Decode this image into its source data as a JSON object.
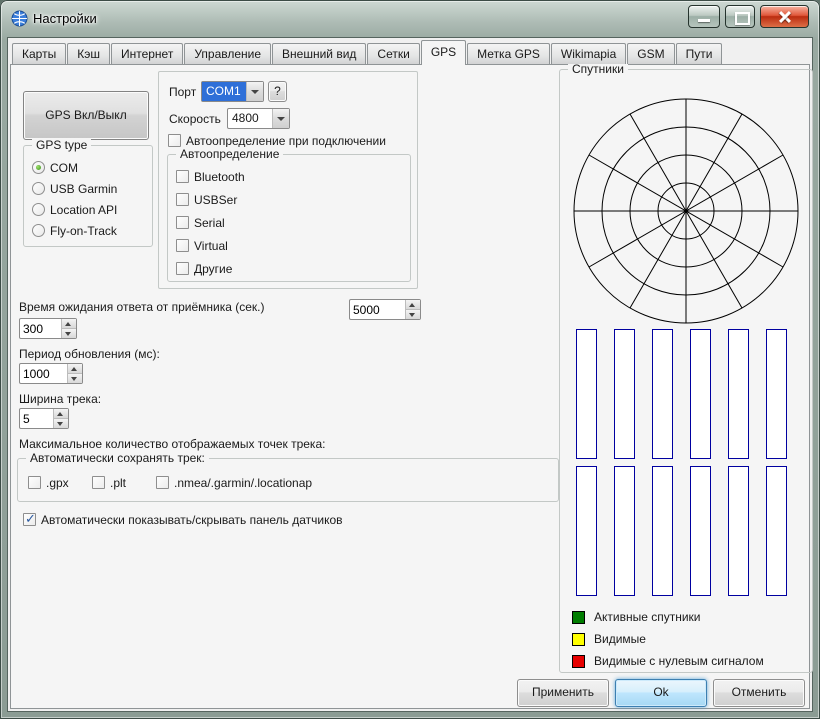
{
  "window": {
    "title": "Настройки"
  },
  "tabs": {
    "items": [
      "Карты",
      "Кэш",
      "Интернет",
      "Управление",
      "Внешний вид",
      "Сетки",
      "GPS",
      "Метка GPS",
      "Wikimapia",
      "GSM",
      "Пути"
    ],
    "active": "GPS"
  },
  "gps": {
    "toggle_button": "GPS Вкл/Выкл",
    "type_group": {
      "legend": "GPS type",
      "options": [
        {
          "label": "COM",
          "selected": true
        },
        {
          "label": "USB Garmin",
          "selected": false
        },
        {
          "label": "Location API",
          "selected": false
        },
        {
          "label": "Fly-on-Track",
          "selected": false
        }
      ]
    },
    "port": {
      "label": "Порт",
      "value": "COM1",
      "help_button": "?",
      "speed_label": "Скорость",
      "speed_value": "4800",
      "autodetect_on_connect": {
        "label": "Автоопределение при подключении",
        "checked": false
      },
      "autodetect_group": {
        "legend": "Автоопределение",
        "options": [
          {
            "label": "Bluetooth",
            "checked": false
          },
          {
            "label": "USBSer",
            "checked": false
          },
          {
            "label": "Serial",
            "checked": false
          },
          {
            "label": "Virtual",
            "checked": false
          },
          {
            "label": "Другие",
            "checked": false
          }
        ]
      }
    },
    "timeout": {
      "label": "Время ожидания ответа от приёмника (сек.)",
      "value": "300",
      "value2": "5000"
    },
    "refresh": {
      "label": "Период обновления (мс):",
      "value": "1000"
    },
    "track_width": {
      "label": "Ширина трека:",
      "value": "5"
    },
    "max_points_label": "Максимальное количество отображаемых точек трека:",
    "autosave_group": {
      "legend": "Автоматически сохранять трек:",
      "options": [
        {
          "label": ".gpx",
          "checked": false
        },
        {
          "label": ".plt",
          "checked": false
        },
        {
          "label": ".nmea/.garmin/.locationap",
          "checked": false
        }
      ]
    },
    "sensors_panel": {
      "label": "Автоматически показывать/скрывать панель датчиков",
      "checked": true
    }
  },
  "satellites": {
    "legend": "Спутники",
    "legend_items": [
      {
        "color": "#007d00",
        "label": "Активные спутники"
      },
      {
        "color": "#ffff00",
        "label": "Видимые"
      },
      {
        "color": "#e60000",
        "label": "Видимые с нулевым сигналом"
      }
    ]
  },
  "footer": {
    "apply": "Применить",
    "ok": "Ok",
    "cancel": "Отменить"
  }
}
